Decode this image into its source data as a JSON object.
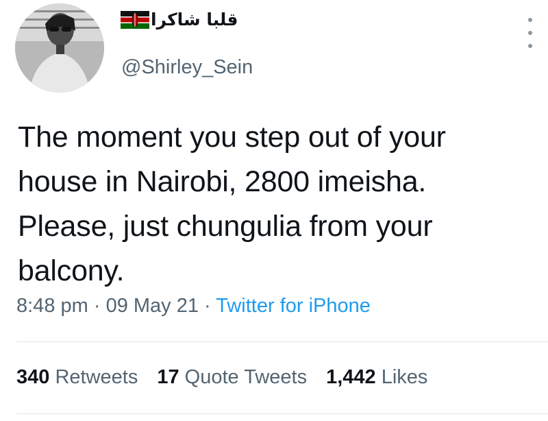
{
  "author": {
    "display_name": "قلبا شاكرا",
    "flag_icon": "kenya-flag-icon",
    "handle": "@Shirley_Sein",
    "avatar_icon": "profile-photo"
  },
  "tweet": {
    "lines": [
      "The moment you step out of your",
      "house in Nairobi, 2800 imeisha.",
      "Please, just chungulia from your",
      "balcony."
    ]
  },
  "meta": {
    "time": "8:48 pm",
    "sep1": " · ",
    "date": "09 May 21",
    "sep2": " · ",
    "source": "Twitter for iPhone"
  },
  "stats": {
    "retweets_count": "340",
    "retweets_label": "Retweets",
    "quotes_count": "17",
    "quotes_label": "Quote Tweets",
    "likes_count": "1,442",
    "likes_label": "Likes"
  },
  "colors": {
    "text": "#0f1419",
    "secondary": "#536471",
    "link": "#1d9bf0",
    "divider": "#e1e6ea"
  }
}
